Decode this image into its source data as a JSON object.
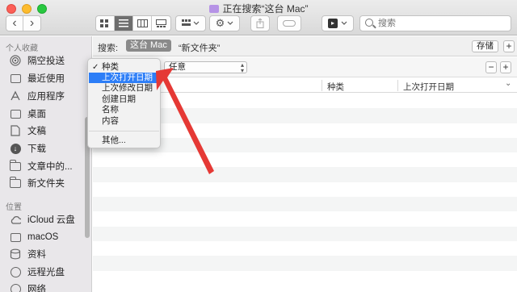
{
  "window": {
    "title": "正在搜索“这台 Mac”"
  },
  "toolbar": {
    "back_label": "‹",
    "forward_label": "›",
    "search_placeholder": "搜索"
  },
  "sidebar": {
    "favorites_header": "个人收藏",
    "favorites": [
      {
        "label": "隔空投送",
        "icon": "airdrop-icon"
      },
      {
        "label": "最近使用",
        "icon": "recents-icon"
      },
      {
        "label": "应用程序",
        "icon": "applications-icon"
      },
      {
        "label": "桌面",
        "icon": "desktop-icon"
      },
      {
        "label": "文稿",
        "icon": "documents-icon"
      },
      {
        "label": "下载",
        "icon": "downloads-icon"
      },
      {
        "label": "文章中的...",
        "icon": "folder-icon"
      },
      {
        "label": "新文件夹",
        "icon": "folder-icon"
      }
    ],
    "locations_header": "位置",
    "locations": [
      {
        "label": "iCloud 云盘",
        "icon": "icloud-icon"
      },
      {
        "label": "macOS",
        "icon": "disk-icon"
      },
      {
        "label": "资料",
        "icon": "disk-icon"
      },
      {
        "label": "远程光盘",
        "icon": "optical-disc-icon"
      },
      {
        "label": "网络",
        "icon": "network-icon"
      }
    ]
  },
  "search_bar": {
    "label": "搜索:",
    "scope_this_mac": "这台 Mac",
    "scope_folder": "“新文件夹”",
    "save_label": "存储",
    "remove_label": "−",
    "add_label": "+"
  },
  "criteria": {
    "value_label": "任意",
    "remove_label": "−",
    "add_label": "+"
  },
  "columns": {
    "kind": "种类",
    "last_opened": "上次打开日期"
  },
  "attribute_menu": {
    "checked_item": "种类",
    "items": [
      "上次打开日期",
      "上次修改日期",
      "创建日期",
      "名称",
      "内容"
    ],
    "highlighted_index": 0,
    "other_label": "其他..."
  },
  "colors": {
    "highlight": "#2d7ef7",
    "annotation_arrow": "#e53935"
  }
}
